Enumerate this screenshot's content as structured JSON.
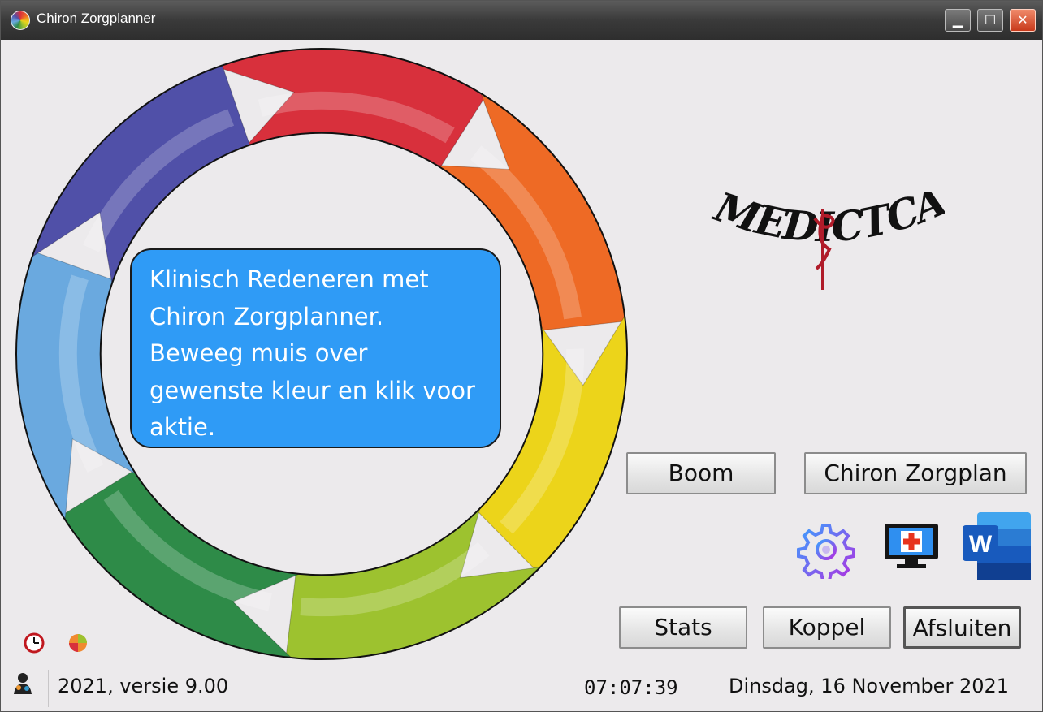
{
  "window": {
    "title": "Chiron Zorgplanner",
    "close_glyph": "✕",
    "minimize_glyph": "▁",
    "maximize_glyph": "☐"
  },
  "wheel": {
    "colors": [
      "#d8303c",
      "#ee6a25",
      "#ecd41a",
      "#9dc22f",
      "#2e8b48",
      "#6aa9df",
      "#5050a8"
    ],
    "message": "Klinisch Redeneren met Chiron Zorgplanner. Beweeg muis over gewenste kleur en klik voor aktie."
  },
  "logo": {
    "text": "MEDICTCARE"
  },
  "buttons": {
    "boom": "Boom",
    "chiron_zorgplan": "Chiron Zorgplan",
    "stats": "Stats",
    "koppel": "Koppel",
    "afsluiten": "Afsluiten"
  },
  "icons": {
    "settings": "gear-icon",
    "monitor": "medical-monitor-icon",
    "word": "word-icon",
    "word_letter": "W",
    "clock": "clock-icon",
    "app": "chiron-icon",
    "status": "person-icon"
  },
  "status": {
    "version": "2021, versie 9.00",
    "time": "07:07:39",
    "date": "Dinsdag, 16 November 2021"
  }
}
